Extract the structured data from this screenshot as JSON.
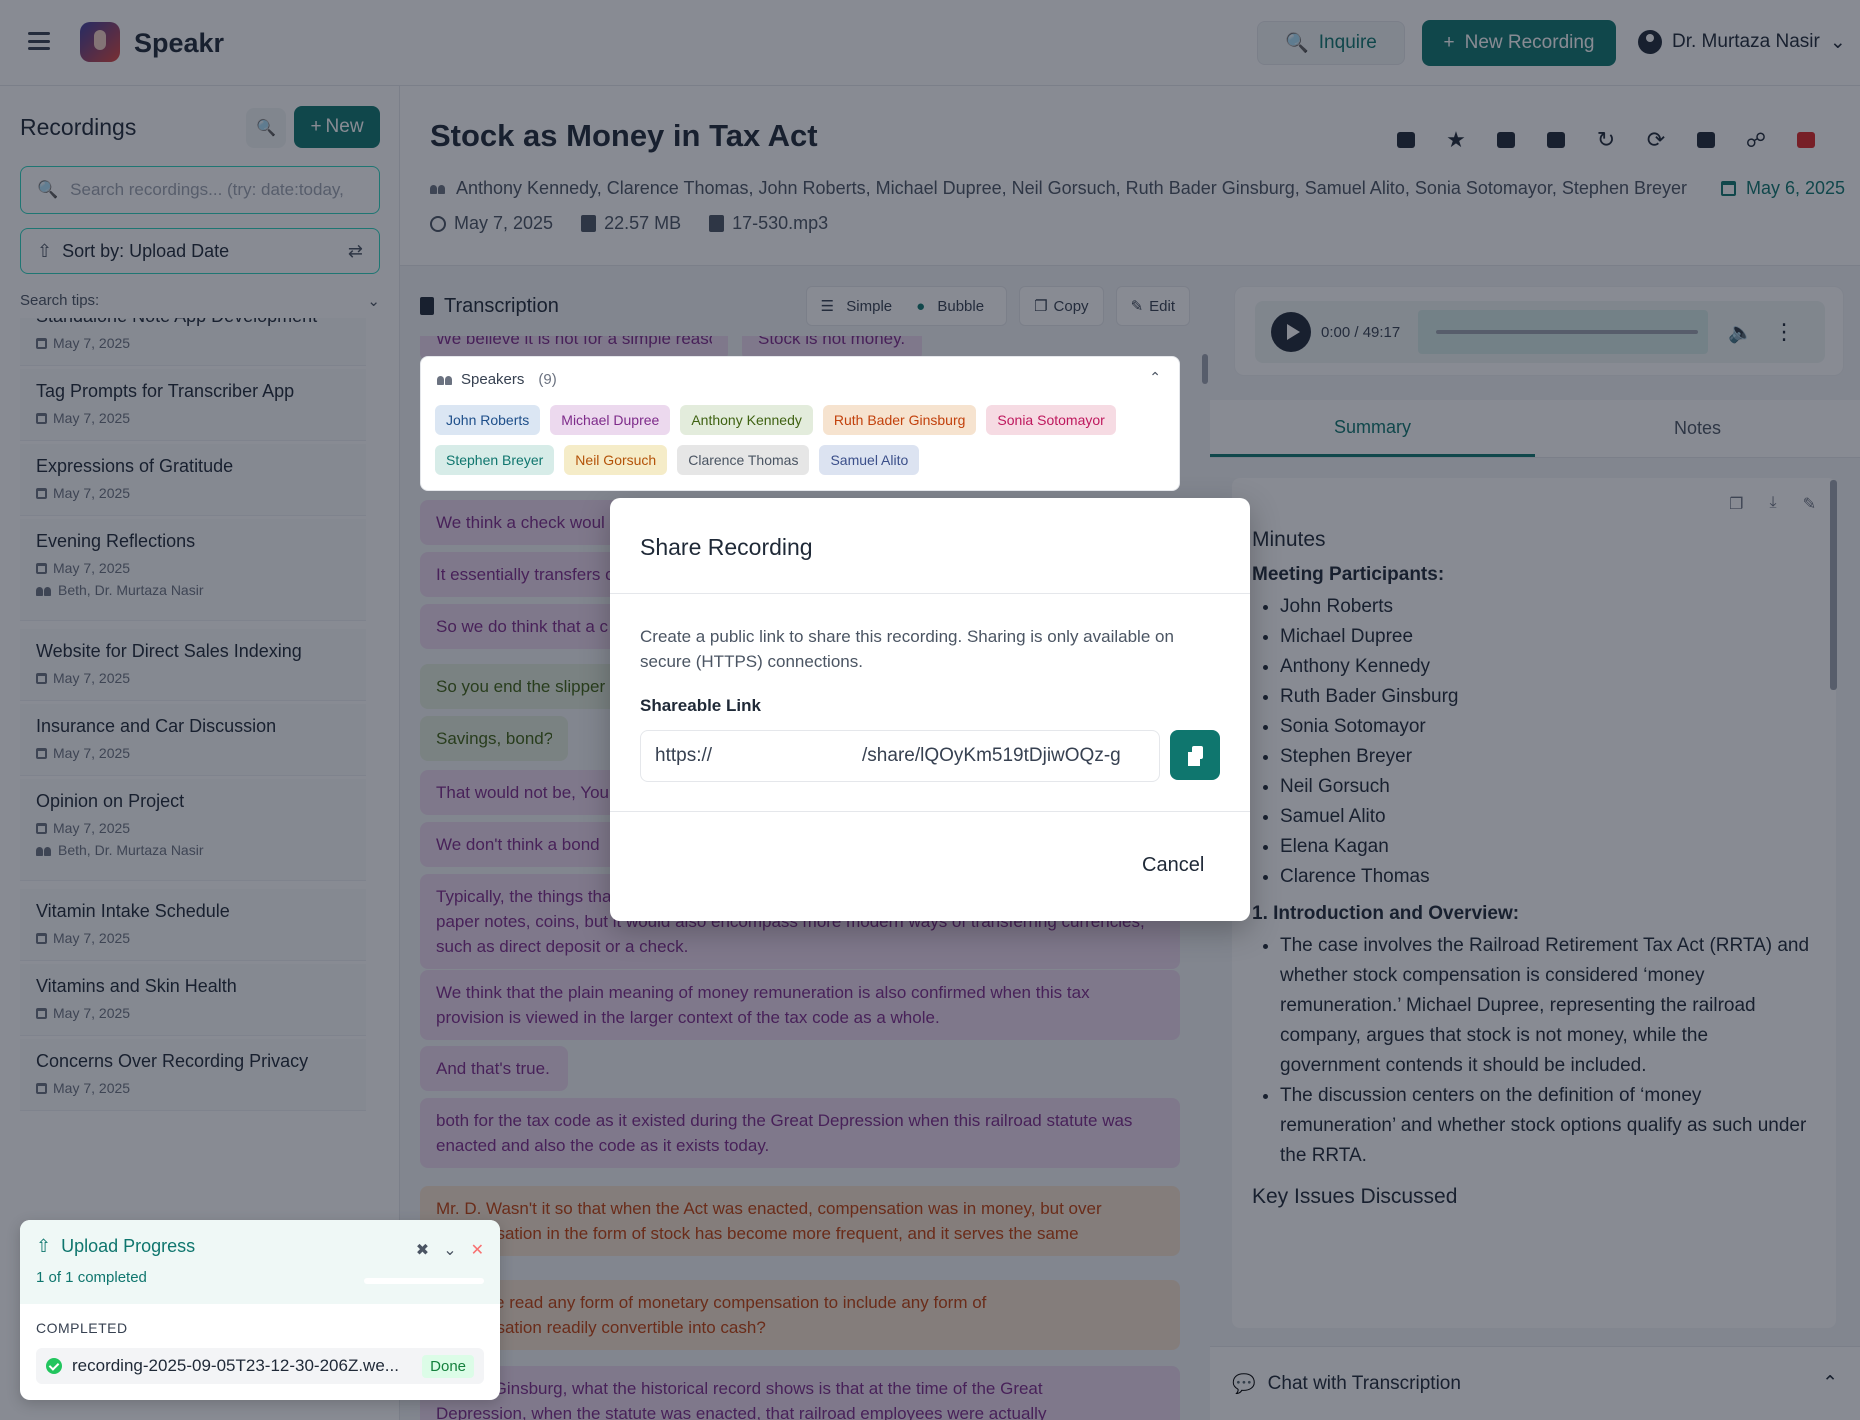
{
  "header": {
    "app_name": "Speakr",
    "inquire_label": "Inquire",
    "new_recording_label": "New Recording",
    "user_name": "Dr. Murtaza Nasir"
  },
  "sidebar": {
    "title": "Recordings",
    "new_label": "New",
    "search_placeholder": "Search recordings... (try: date:today,",
    "sort_label": "Sort by: Upload Date",
    "search_tips": "Search tips:",
    "items": [
      {
        "title": "Standalone Note App Development",
        "date": "May 7, 2025",
        "people": ""
      },
      {
        "title": "Tag Prompts for Transcriber App",
        "date": "May 7, 2025",
        "people": ""
      },
      {
        "title": "Expressions of Gratitude",
        "date": "May 7, 2025",
        "people": ""
      },
      {
        "title": "Evening Reflections",
        "date": "May 7, 2025",
        "people": "Beth, Dr. Murtaza Nasir"
      },
      {
        "title": "Website for Direct Sales Indexing",
        "date": "May 7, 2025",
        "people": ""
      },
      {
        "title": "Insurance and Car Discussion",
        "date": "May 7, 2025",
        "people": ""
      },
      {
        "title": "Opinion on Project",
        "date": "May 7, 2025",
        "people": "Beth, Dr. Murtaza Nasir"
      },
      {
        "title": "Vitamin Intake Schedule",
        "date": "May 7, 2025",
        "people": ""
      },
      {
        "title": "Vitamins and Skin Health",
        "date": "May 7, 2025",
        "people": ""
      },
      {
        "title": "Concerns Over Recording Privacy",
        "date": "May 7, 2025",
        "people": ""
      }
    ]
  },
  "upload": {
    "title": "Upload Progress",
    "summary": "1 of 1 completed",
    "section": "COMPLETED",
    "file": "recording-2025-09-05T23-12-30-206Z.we...",
    "status": "Done"
  },
  "recording": {
    "title": "Stock as Money in Tax Act",
    "participants": "Anthony Kennedy, Clarence Thomas, John Roberts, Michael Dupree, Neil Gorsuch, Ruth Bader Ginsburg, Samuel Alito, Sonia Sotomayor, Stephen Breyer",
    "meeting_date": "May 6, 2025",
    "upload_date": "May 7, 2025",
    "size": "22.57 MB",
    "filename": "17-530.mp3"
  },
  "transcription": {
    "title": "Transcription",
    "simple_label": "Simple",
    "bubble_label": "Bubble",
    "copy_label": "Copy",
    "edit_label": "Edit",
    "speakers_label": "Speakers",
    "speakers_count": "(9)",
    "speakers": [
      {
        "name": "John Roberts",
        "bg": "#dbe6f3",
        "fg": "#1e4f8a"
      },
      {
        "name": "Michael Dupree",
        "bg": "#ecd9ee",
        "fg": "#7e2b8a"
      },
      {
        "name": "Anthony Kennedy",
        "bg": "#e3ecdc",
        "fg": "#3f6212"
      },
      {
        "name": "Ruth Bader Ginsburg",
        "bg": "#f6e3cf",
        "fg": "#c2410c"
      },
      {
        "name": "Sonia Sotomayor",
        "bg": "#f6dbe3",
        "fg": "#be185d"
      },
      {
        "name": "Stephen Breyer",
        "bg": "#d7ece8",
        "fg": "#0f766e"
      },
      {
        "name": "Neil Gorsuch",
        "bg": "#f5ecc8",
        "fg": "#b45309"
      },
      {
        "name": "Clarence Thomas",
        "bg": "#e6e6e6",
        "fg": "#4b5563"
      },
      {
        "name": "Samuel Alito",
        "bg": "#dce3f1",
        "fg": "#3b4f8a"
      }
    ],
    "bubbles": [
      {
        "text": "We believe it is not for a simple reason.",
        "color": "purple"
      },
      {
        "text": "Stock is not money.",
        "color": "purple"
      },
      {
        "text": "We think a check woul",
        "color": "purple"
      },
      {
        "text": "It essentially transfers c",
        "color": "purple"
      },
      {
        "text": "So we do think that a c",
        "color": "purple"
      },
      {
        "text": "So you end the slipper",
        "color": "green"
      },
      {
        "text": "Savings, bond?",
        "color": "green"
      },
      {
        "text": "That would not be, You",
        "color": "purple"
      },
      {
        "text": "We don't think a bond",
        "color": "purple"
      },
      {
        "text": "Typically, the things tha",
        "color": "purple"
      },
      {
        "text": "paper notes, coins, but it would also encompass more modern ways of transferring currencies,",
        "color": "purple"
      },
      {
        "text": "such as direct deposit or a check.",
        "color": "purple"
      },
      {
        "text": "We think that the plain meaning of money remuneration is also confirmed when this tax",
        "color": "purple"
      },
      {
        "text": "provision is viewed in the larger context of the tax code as a whole.",
        "color": "purple"
      },
      {
        "text": "And that's true.",
        "color": "purple"
      },
      {
        "text": "both for the tax code as it existed during the Great Depression when this railroad statute was",
        "color": "purple"
      },
      {
        "text": "enacted and also the code as it exists today.",
        "color": "purple"
      },
      {
        "text": "Mr. D. Wasn't it so that when the Act was enacted, compensation was in money, but over",
        "color": "orange"
      },
      {
        "text": "compensation in the form of stock has become more frequent, and it serves the same",
        "color": "orange"
      },
      {
        "text": "can't one read any form of monetary compensation to include any form of",
        "color": "orange"
      },
      {
        "text": "compensation readily convertible into cash?",
        "color": "orange"
      },
      {
        "text": "Justice Ginsburg, what the historical record shows is that at the time of the Great",
        "color": "purple"
      },
      {
        "text": "Depression, when the statute was enacted, that railroad employees were actually",
        "color": "purple"
      }
    ]
  },
  "player": {
    "time": "0:00 / 49:17"
  },
  "tabs": {
    "summary": "Summary",
    "notes": "Notes"
  },
  "summary": {
    "heading": "Minutes",
    "participants_heading": "Meeting Participants:",
    "participants": [
      "John Roberts",
      "Michael Dupree",
      "Anthony Kennedy",
      "Ruth Bader Ginsburg",
      "Sonia Sotomayor",
      "Stephen Breyer",
      "Neil Gorsuch",
      "Samuel Alito",
      "Elena Kagan",
      "Clarence Thomas"
    ],
    "section1": "1. Introduction and Overview:",
    "points": [
      "The case involves the Railroad Retirement Tax Act (RRTA) and whether stock compensation is considered ‘money remuneration.’ Michael Dupree, representing the railroad company, argues that stock is not money, while the government contends it should be included.",
      "The discussion centers on the definition of ‘money remuneration’ and whether stock options qualify as such under the RRTA."
    ],
    "section2": "Key Issues Discussed"
  },
  "chat": {
    "label": "Chat with Transcription"
  },
  "modal": {
    "title": "Share Recording",
    "description": "Create a public link to share this recording. Sharing is only available on secure (HTTPS) connections.",
    "link_label": "Shareable Link",
    "link_prefix": "https://",
    "link_suffix": "/share/lQOyKm519tDjiwOQz-g",
    "cancel_label": "Cancel"
  }
}
